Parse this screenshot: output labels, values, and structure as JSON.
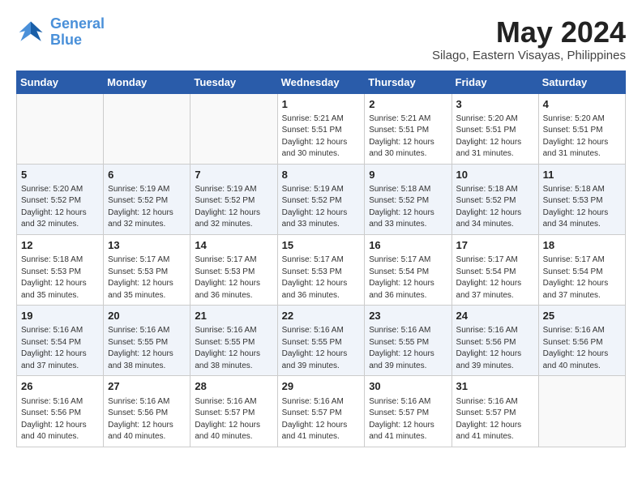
{
  "header": {
    "logo_line1": "General",
    "logo_line2": "Blue",
    "month_year": "May 2024",
    "location": "Silago, Eastern Visayas, Philippines"
  },
  "days_of_week": [
    "Sunday",
    "Monday",
    "Tuesday",
    "Wednesday",
    "Thursday",
    "Friday",
    "Saturday"
  ],
  "weeks": [
    [
      {
        "day": "",
        "info": ""
      },
      {
        "day": "",
        "info": ""
      },
      {
        "day": "",
        "info": ""
      },
      {
        "day": "1",
        "info": "Sunrise: 5:21 AM\nSunset: 5:51 PM\nDaylight: 12 hours\nand 30 minutes."
      },
      {
        "day": "2",
        "info": "Sunrise: 5:21 AM\nSunset: 5:51 PM\nDaylight: 12 hours\nand 30 minutes."
      },
      {
        "day": "3",
        "info": "Sunrise: 5:20 AM\nSunset: 5:51 PM\nDaylight: 12 hours\nand 31 minutes."
      },
      {
        "day": "4",
        "info": "Sunrise: 5:20 AM\nSunset: 5:51 PM\nDaylight: 12 hours\nand 31 minutes."
      }
    ],
    [
      {
        "day": "5",
        "info": "Sunrise: 5:20 AM\nSunset: 5:52 PM\nDaylight: 12 hours\nand 32 minutes."
      },
      {
        "day": "6",
        "info": "Sunrise: 5:19 AM\nSunset: 5:52 PM\nDaylight: 12 hours\nand 32 minutes."
      },
      {
        "day": "7",
        "info": "Sunrise: 5:19 AM\nSunset: 5:52 PM\nDaylight: 12 hours\nand 32 minutes."
      },
      {
        "day": "8",
        "info": "Sunrise: 5:19 AM\nSunset: 5:52 PM\nDaylight: 12 hours\nand 33 minutes."
      },
      {
        "day": "9",
        "info": "Sunrise: 5:18 AM\nSunset: 5:52 PM\nDaylight: 12 hours\nand 33 minutes."
      },
      {
        "day": "10",
        "info": "Sunrise: 5:18 AM\nSunset: 5:52 PM\nDaylight: 12 hours\nand 34 minutes."
      },
      {
        "day": "11",
        "info": "Sunrise: 5:18 AM\nSunset: 5:53 PM\nDaylight: 12 hours\nand 34 minutes."
      }
    ],
    [
      {
        "day": "12",
        "info": "Sunrise: 5:18 AM\nSunset: 5:53 PM\nDaylight: 12 hours\nand 35 minutes."
      },
      {
        "day": "13",
        "info": "Sunrise: 5:17 AM\nSunset: 5:53 PM\nDaylight: 12 hours\nand 35 minutes."
      },
      {
        "day": "14",
        "info": "Sunrise: 5:17 AM\nSunset: 5:53 PM\nDaylight: 12 hours\nand 36 minutes."
      },
      {
        "day": "15",
        "info": "Sunrise: 5:17 AM\nSunset: 5:53 PM\nDaylight: 12 hours\nand 36 minutes."
      },
      {
        "day": "16",
        "info": "Sunrise: 5:17 AM\nSunset: 5:54 PM\nDaylight: 12 hours\nand 36 minutes."
      },
      {
        "day": "17",
        "info": "Sunrise: 5:17 AM\nSunset: 5:54 PM\nDaylight: 12 hours\nand 37 minutes."
      },
      {
        "day": "18",
        "info": "Sunrise: 5:17 AM\nSunset: 5:54 PM\nDaylight: 12 hours\nand 37 minutes."
      }
    ],
    [
      {
        "day": "19",
        "info": "Sunrise: 5:16 AM\nSunset: 5:54 PM\nDaylight: 12 hours\nand 37 minutes."
      },
      {
        "day": "20",
        "info": "Sunrise: 5:16 AM\nSunset: 5:55 PM\nDaylight: 12 hours\nand 38 minutes."
      },
      {
        "day": "21",
        "info": "Sunrise: 5:16 AM\nSunset: 5:55 PM\nDaylight: 12 hours\nand 38 minutes."
      },
      {
        "day": "22",
        "info": "Sunrise: 5:16 AM\nSunset: 5:55 PM\nDaylight: 12 hours\nand 39 minutes."
      },
      {
        "day": "23",
        "info": "Sunrise: 5:16 AM\nSunset: 5:55 PM\nDaylight: 12 hours\nand 39 minutes."
      },
      {
        "day": "24",
        "info": "Sunrise: 5:16 AM\nSunset: 5:56 PM\nDaylight: 12 hours\nand 39 minutes."
      },
      {
        "day": "25",
        "info": "Sunrise: 5:16 AM\nSunset: 5:56 PM\nDaylight: 12 hours\nand 40 minutes."
      }
    ],
    [
      {
        "day": "26",
        "info": "Sunrise: 5:16 AM\nSunset: 5:56 PM\nDaylight: 12 hours\nand 40 minutes."
      },
      {
        "day": "27",
        "info": "Sunrise: 5:16 AM\nSunset: 5:56 PM\nDaylight: 12 hours\nand 40 minutes."
      },
      {
        "day": "28",
        "info": "Sunrise: 5:16 AM\nSunset: 5:57 PM\nDaylight: 12 hours\nand 40 minutes."
      },
      {
        "day": "29",
        "info": "Sunrise: 5:16 AM\nSunset: 5:57 PM\nDaylight: 12 hours\nand 41 minutes."
      },
      {
        "day": "30",
        "info": "Sunrise: 5:16 AM\nSunset: 5:57 PM\nDaylight: 12 hours\nand 41 minutes."
      },
      {
        "day": "31",
        "info": "Sunrise: 5:16 AM\nSunset: 5:57 PM\nDaylight: 12 hours\nand 41 minutes."
      },
      {
        "day": "",
        "info": ""
      }
    ]
  ]
}
